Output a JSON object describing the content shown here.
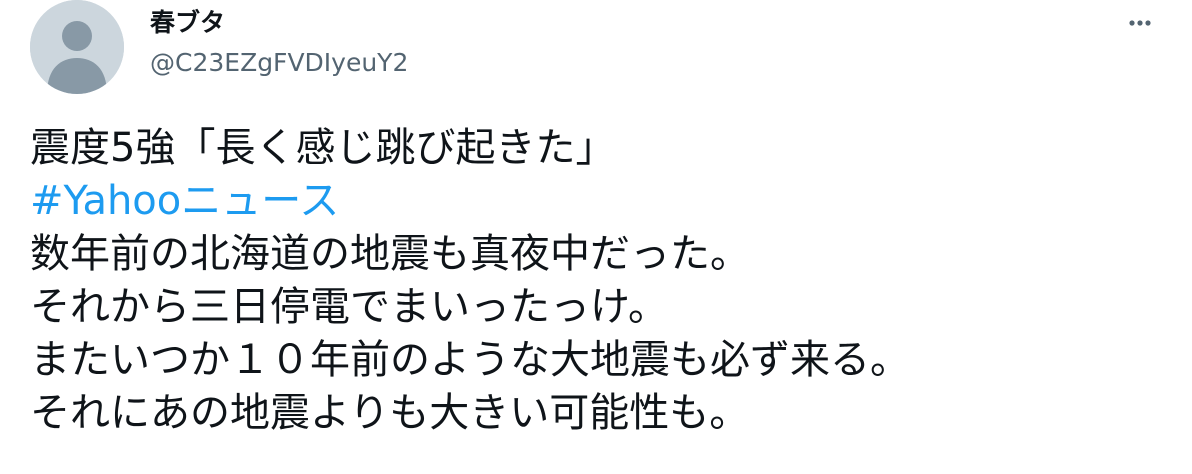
{
  "author": {
    "display_name": "春ブタ",
    "handle": "@C23EZgFVDIyeuY2",
    "avatar_icon": "default-profile-icon"
  },
  "menu": {
    "icon": "more-options-icon"
  },
  "tweet": {
    "line1": "震度5強「長く感じ跳び起きた」",
    "hashtag": "#Yahooニュース",
    "line3": "数年前の北海道の地震も真夜中だった。",
    "line4": "それから三日停電でまいったっけ。",
    "line5": "またいつか１０年前のような大地震も必ず来る。",
    "line6": "それにあの地震よりも大きい可能性も。"
  },
  "colors": {
    "text": "#0f1419",
    "secondary": "#536471",
    "link": "#1d9bf0",
    "avatar_bg": "#ccd6dd",
    "avatar_fg": "#8899a6"
  }
}
